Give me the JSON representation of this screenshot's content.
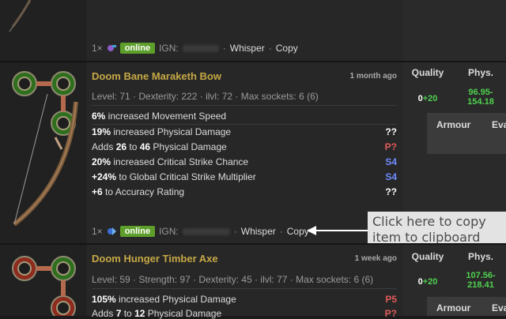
{
  "colors": {
    "online": "#5e9e2a",
    "title": "#c6a846",
    "prefix": "#e05a5a",
    "suffix": "#6e8cff",
    "quality_bonus": "#4fd14f"
  },
  "top_listing": {
    "quantity": "1×",
    "currency_icon": "orb-icon",
    "status": "online",
    "ign_label": "IGN:",
    "whisper": "Whisper",
    "copy": "Copy",
    "dot": "·"
  },
  "item1": {
    "name": "Doom Bane Maraketh Bow",
    "age": "1 month ago",
    "properties": "Level: 71 · Dexterity: 222 · ilvl: 72 · Max sockets: 6 (6)",
    "implicit": {
      "value": "6%",
      "text": " increased Movement Speed"
    },
    "mods": [
      {
        "value": "19%",
        "text": " increased Physical Damage",
        "tag": "??"
      },
      {
        "pre": "Adds ",
        "value": "26",
        "mid": " to ",
        "value2": "46",
        "text": " Physical Damage",
        "tag": "P?"
      },
      {
        "value": "20%",
        "text": " increased Critical Strike Chance",
        "tag": "S4"
      },
      {
        "value": "+24%",
        "text": " to Global Critical Strike Multiplier",
        "tag": "S4"
      },
      {
        "value": "+6",
        "text": " to Accuracy Rating",
        "tag": "??"
      }
    ],
    "listing": {
      "quantity": "1×",
      "currency_icon": "exalted-orb-icon",
      "status": "online",
      "ign_label": "IGN:",
      "whisper": "Whisper",
      "copy": "Copy",
      "dot": "·"
    },
    "stats": {
      "quality_label": "Quality",
      "phys_label": "Phys.",
      "quality_base": "0",
      "quality_bonus": "+20",
      "phys_line1": "96.95-",
      "phys_line2": "154.18",
      "armour_label": "Armour",
      "eva_label": "Eva"
    }
  },
  "callout": {
    "line1": "Click here to copy",
    "line2": "item to clipboard"
  },
  "item2": {
    "name": "Doom Hunger Timber Axe",
    "age": "1 week ago",
    "properties": "Level: 59 · Strength: 97 · Dexterity: 45 · ilvl: 77 · Max sockets: 6 (6)",
    "mods": [
      {
        "value": "105%",
        "text": " increased Physical Damage",
        "tag": "P5"
      },
      {
        "pre": "Adds ",
        "value": "7",
        "mid": " to ",
        "value2": "12",
        "text": " Physical Damage",
        "tag": "P?"
      }
    ],
    "stats": {
      "quality_label": "Quality",
      "phys_label": "Phys.",
      "quality_base": "0",
      "quality_bonus": "+20",
      "phys_line1": "107.56-",
      "phys_line2": "218.41",
      "armour_label": "Armour",
      "eva_label": "Eva"
    }
  }
}
